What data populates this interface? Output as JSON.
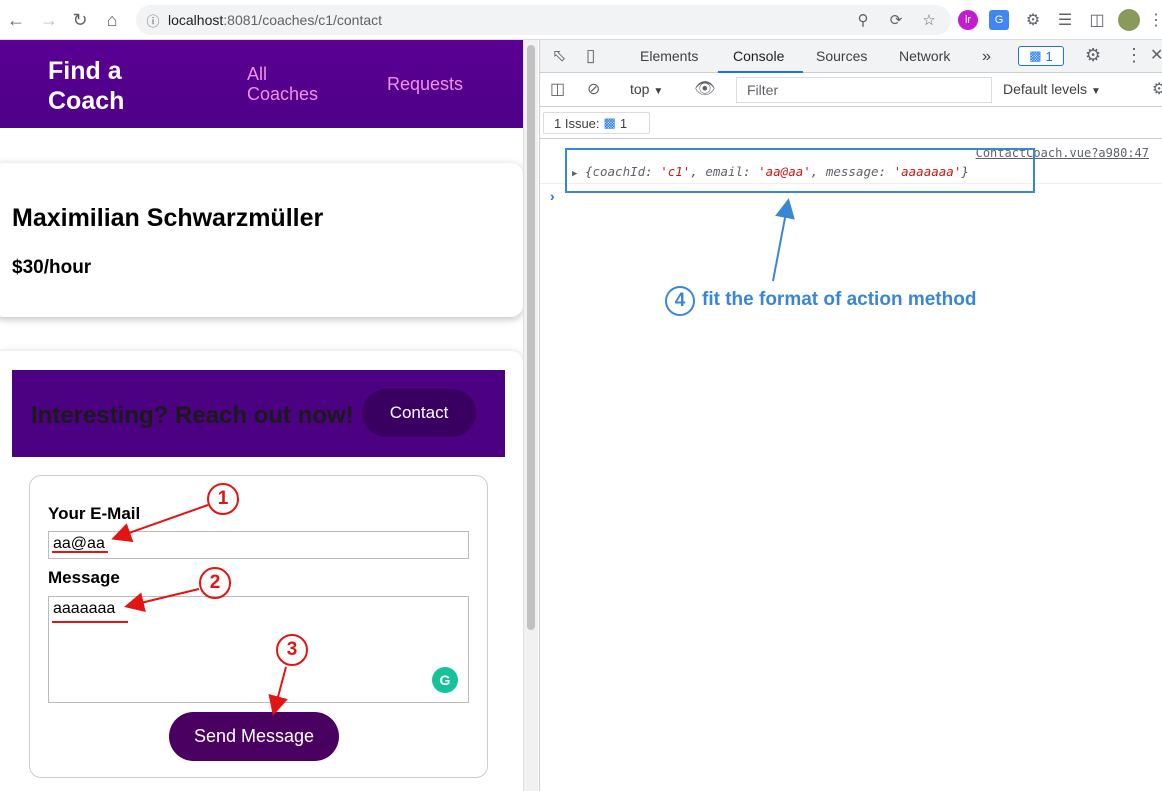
{
  "browser": {
    "url_host": "localhost",
    "url_path": ":8081/coaches/c1/contact"
  },
  "app": {
    "brand": "Find a Coach",
    "nav_all": "All Coaches",
    "nav_requests": "Requests"
  },
  "coach": {
    "name": "Maximilian Schwarzmüller",
    "rate": "$30/hour"
  },
  "reach": {
    "text": "Interesting? Reach out now!",
    "contact_label": "Contact"
  },
  "form": {
    "email_label": "Your E-Mail",
    "email_value": "aa@aa",
    "message_label": "Message",
    "message_value": "aaaaaaa",
    "send_label": "Send Message"
  },
  "devtools": {
    "tabs": [
      "Elements",
      "Console",
      "Sources",
      "Network"
    ],
    "active_tab": "Console",
    "issues_count": "1",
    "context": "top",
    "filter_placeholder": "Filter",
    "levels": "Default levels",
    "issues_label": "1 Issue:",
    "issues_num": "1",
    "log_source": "ContactCoach.vue?a980:47",
    "log": {
      "k1": "coachId",
      "v1": "'c1'",
      "k2": "email",
      "v2": "'aa@aa'",
      "k3": "message",
      "v3": "'aaaaaaa'"
    }
  },
  "annotations": {
    "n1": "1",
    "n2": "2",
    "n3": "3",
    "n4": "4",
    "note4": "fit the format of action method"
  },
  "colors": {
    "header_purple": "#4e0088",
    "annotation_red": "#e31414",
    "annotation_blue": "#3a86d6"
  }
}
